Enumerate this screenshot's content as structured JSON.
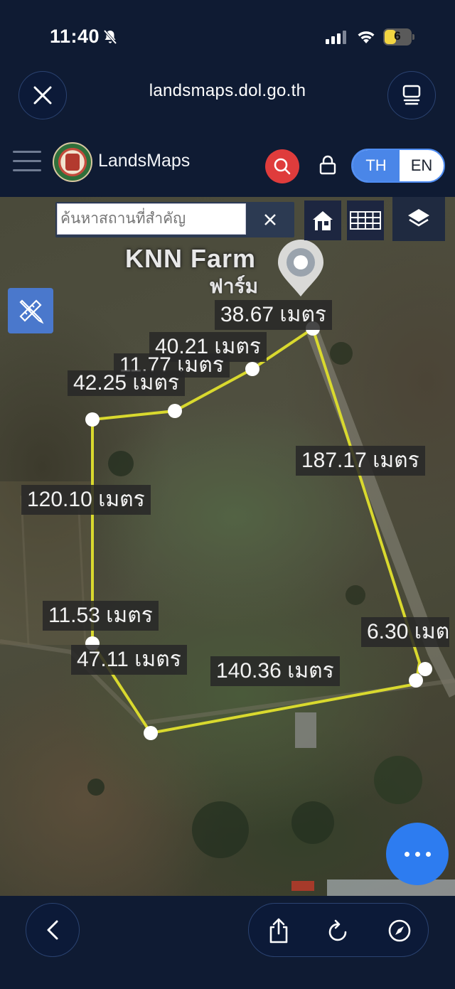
{
  "status_bar": {
    "time": "11:40",
    "battery_level": "6"
  },
  "browser": {
    "url": "landsmaps.dol.go.th"
  },
  "app": {
    "brand": "LandsMaps",
    "lang_th": "TH",
    "lang_en": "EN",
    "selected_lang": "TH"
  },
  "map": {
    "search_placeholder": "ค้นหาสถานที่สำคัญ",
    "place_name": "KNN Farm",
    "place_name_th": "ฟาร์ม",
    "measurements": [
      "38.67 เมตร",
      "40.21 เมตร",
      "11.77 เมตร",
      "42.25 เมตร",
      "187.17 เมตร",
      "120.10 เมตร",
      "11.53 เมตร",
      "6.30 เมต",
      "47.11 เมตร",
      "140.36 เมตร"
    ]
  },
  "colors": {
    "background": "#0f1b33",
    "accent_blue": "#4a86e8",
    "search_red": "#df3c3c",
    "polygon_line": "#d9d92e",
    "fab_blue": "#2d7cf0"
  },
  "icons": [
    "close-icon",
    "tabs-icon",
    "menu-icon",
    "search-icon",
    "lock-icon",
    "clear-icon",
    "home-icon",
    "grid-icon",
    "layers-icon",
    "ruler-pencil-icon",
    "location-pin-icon",
    "more-icon",
    "chevron-left-icon",
    "share-icon",
    "reload-icon",
    "compass-icon"
  ]
}
